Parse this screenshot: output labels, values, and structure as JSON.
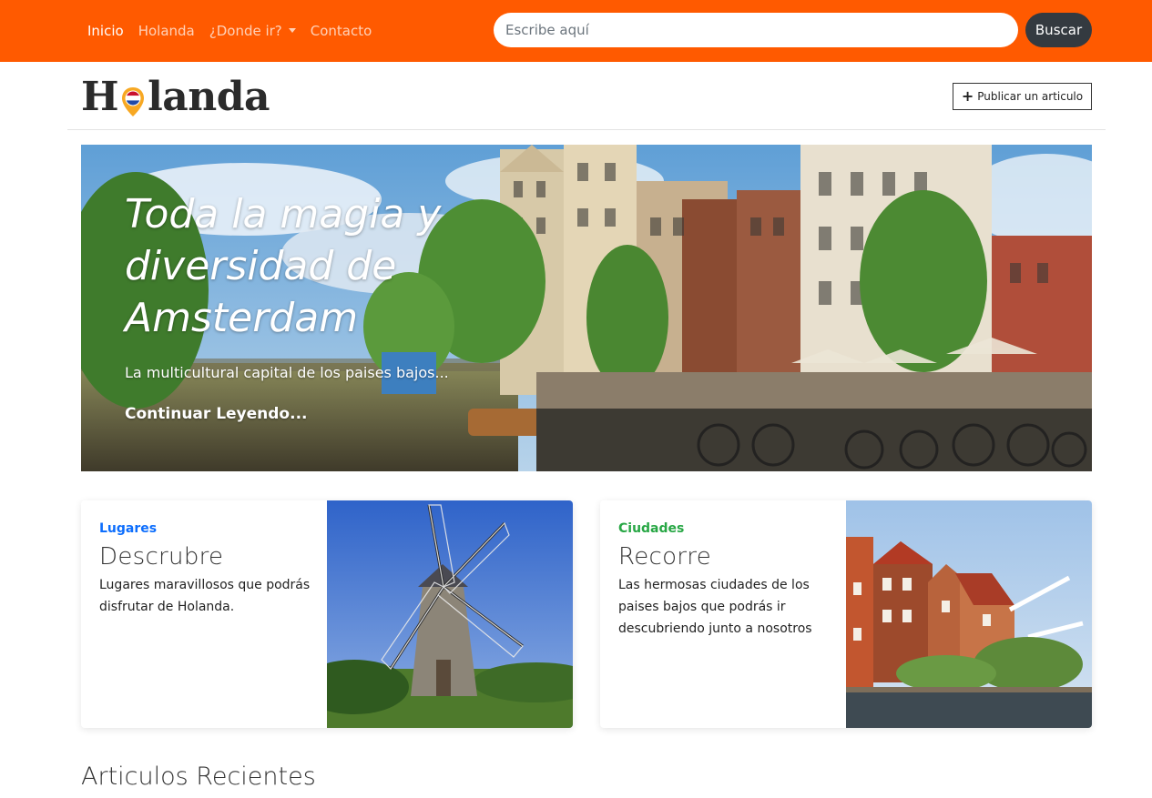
{
  "navbar": {
    "links": [
      {
        "label": "Inicio",
        "active": true
      },
      {
        "label": "Holanda",
        "active": false
      },
      {
        "label": "¿Donde ir?",
        "active": false
      },
      {
        "label": "Contacto",
        "active": false
      }
    ],
    "search": {
      "placeholder": "Escribe aquí",
      "value": "",
      "button_label": "Buscar"
    },
    "background_color": "#ff5a00"
  },
  "header": {
    "brand_left": "H",
    "brand_right": "landa",
    "brand_icon": "netherlands-map-pin-icon",
    "publish_button": {
      "icon": "plus-icon",
      "icon_glyph": "+",
      "label": "Publicar un articulo"
    }
  },
  "hero": {
    "title": "Toda la magia y diversidad de Amsterdam",
    "subtitle": "La multicultural capital de los paises bajos...",
    "link_label": "Continuar Leyendo..."
  },
  "cards": [
    {
      "category": "Lugares",
      "category_color": "#0d6efd",
      "title": "Descrubre",
      "text": "Lugares maravillosos que podrás disfrutar de Holanda.",
      "image": "windmill-photo"
    },
    {
      "category": "Ciudades",
      "category_color": "#28a745",
      "title": "Recorre",
      "text": "Las hermosas ciudades de los paises bajos que podrás ir descubriendo junto a nosotros",
      "image": "dutch-town-canal-photo"
    }
  ],
  "recent_section": {
    "heading": "Articulos Recientes"
  }
}
